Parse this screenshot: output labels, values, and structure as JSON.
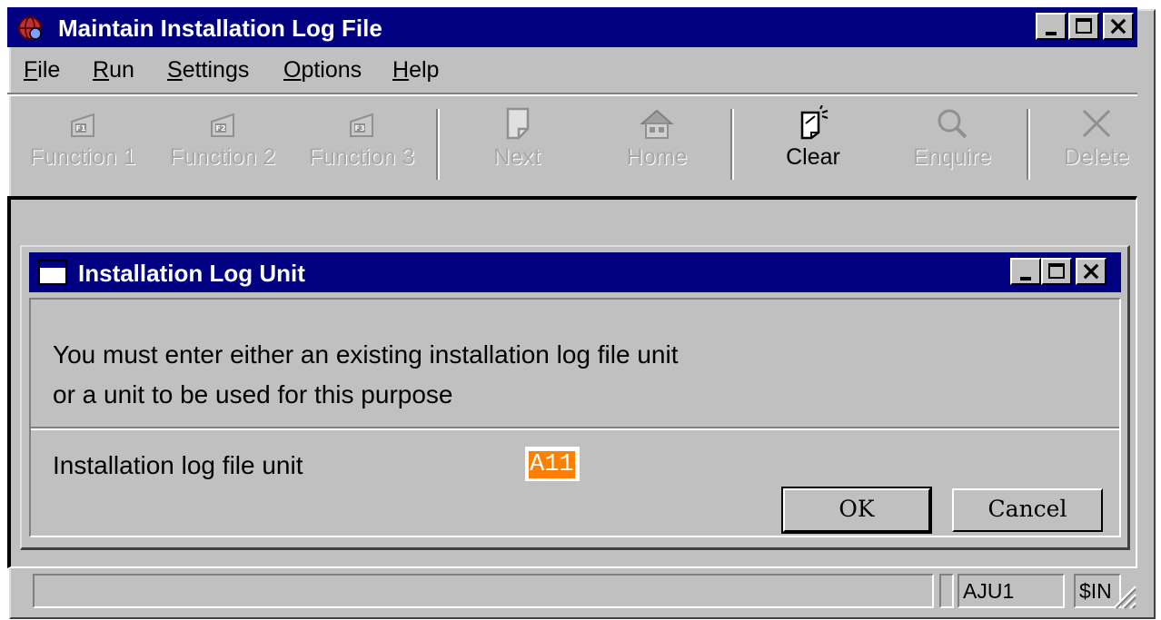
{
  "window": {
    "title": "Maintain Installation Log File",
    "controls": {
      "minimize": "_",
      "maximize": "□",
      "close": "×"
    }
  },
  "menu": {
    "items": [
      {
        "label": "File",
        "mnemonic": "F"
      },
      {
        "label": "Run",
        "mnemonic": "R"
      },
      {
        "label": "Settings",
        "mnemonic": "S"
      },
      {
        "label": "Options",
        "mnemonic": "O"
      },
      {
        "label": "Help",
        "mnemonic": "H"
      }
    ]
  },
  "toolbar": {
    "buttons": [
      {
        "label": "Function 1",
        "icon": "f1-key-icon",
        "key": "F1",
        "enabled": false
      },
      {
        "label": "Function 2",
        "icon": "f2-key-icon",
        "key": "F2",
        "enabled": false
      },
      {
        "label": "Function 3",
        "icon": "f3-key-icon",
        "key": "F3",
        "enabled": false
      },
      {
        "label": "Next",
        "icon": "page-icon",
        "enabled": false
      },
      {
        "label": "Home",
        "icon": "home-icon",
        "enabled": false
      },
      {
        "label": "Clear",
        "icon": "clear-icon",
        "enabled": true
      },
      {
        "label": "Enquire",
        "icon": "magnifier-icon",
        "enabled": false
      },
      {
        "label": "Delete",
        "icon": "delete-x-icon",
        "enabled": false
      }
    ]
  },
  "dialog": {
    "title": "Installation Log Unit",
    "message_line1": "You must enter either an existing installation log file unit",
    "message_line2": "or a unit to be used for this purpose",
    "field_label": "Installation log file unit",
    "field_value": "A11",
    "ok_label": "OK",
    "cancel_label": "Cancel"
  },
  "statusbar": {
    "main": "",
    "user": "AJU1",
    "extra": "$IN"
  },
  "colors": {
    "titlebar": "#000080",
    "face": "#c0c0c0",
    "selection": "#ff8000"
  }
}
